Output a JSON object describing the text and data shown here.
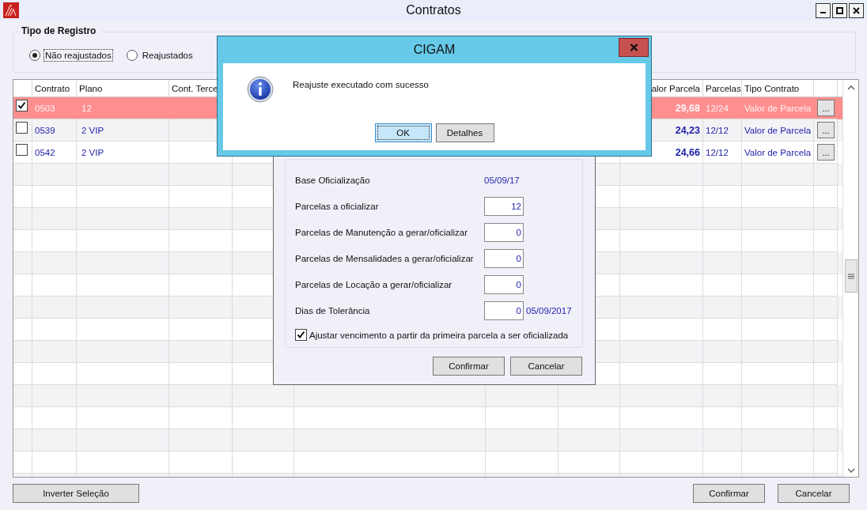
{
  "window": {
    "title": "Contratos"
  },
  "record_type": {
    "title": "Tipo de Registro",
    "options": [
      {
        "label": "Não reajustados",
        "selected": true
      },
      {
        "label": "Reajustados",
        "selected": false
      }
    ]
  },
  "table": {
    "columns": [
      {
        "label": "Contrato"
      },
      {
        "label": "Plano"
      },
      {
        "label": "Cont. Terce"
      },
      {
        "label": "alor Parcela"
      },
      {
        "label": "Parcelas"
      },
      {
        "label": "Tipo Contrato"
      }
    ],
    "rows": [
      {
        "checked": true,
        "selected": true,
        "contrato": "0503",
        "plano": "12",
        "valor": "29,68",
        "parcelas": "12/24",
        "tipo": "Valor de Parcela",
        "action": "..."
      },
      {
        "checked": false,
        "selected": false,
        "contrato": "0539",
        "plano": "2 VIP",
        "valor": "24,23",
        "parcelas": "12/12",
        "tipo": "Valor de Parcela",
        "action": "..."
      },
      {
        "checked": false,
        "selected": false,
        "contrato": "0542",
        "plano": "2 VIP",
        "valor": "24,66",
        "parcelas": "12/12",
        "tipo": "Valor de Parcela",
        "action": "..."
      }
    ]
  },
  "footer": {
    "buttons": [
      "Inverter Seleção",
      "Confirmar",
      "Cancelar"
    ]
  },
  "officialization_dialog": {
    "fields": [
      {
        "label": "Base Oficialização",
        "kind": "text",
        "value": "05/09/17"
      },
      {
        "label": "Parcelas a oficializar",
        "kind": "input",
        "value": "12"
      },
      {
        "label": "Parcelas de Manutenção a gerar/oficializar",
        "kind": "input",
        "value": "0"
      },
      {
        "label": "Parcelas de Mensalidades a gerar/oficializar",
        "kind": "input",
        "value": "0"
      },
      {
        "label": "Parcelas de Locação a gerar/oficializar",
        "kind": "input",
        "value": "0"
      },
      {
        "label": "Dias de Tolerância",
        "kind": "input",
        "value": "0",
        "note": "05/09/2017"
      }
    ],
    "checkbox": {
      "label": "Ajustar vencimento a partir da primeira parcela a ser oficializada",
      "checked": true
    },
    "buttons": [
      "Confirmar",
      "Cancelar"
    ]
  },
  "message_box": {
    "title": "CIGAM",
    "message": "Reajuste executado com sucesso",
    "buttons": [
      {
        "label": "OK",
        "focused": true
      },
      {
        "label": "Detalhes",
        "focused": false
      }
    ]
  }
}
